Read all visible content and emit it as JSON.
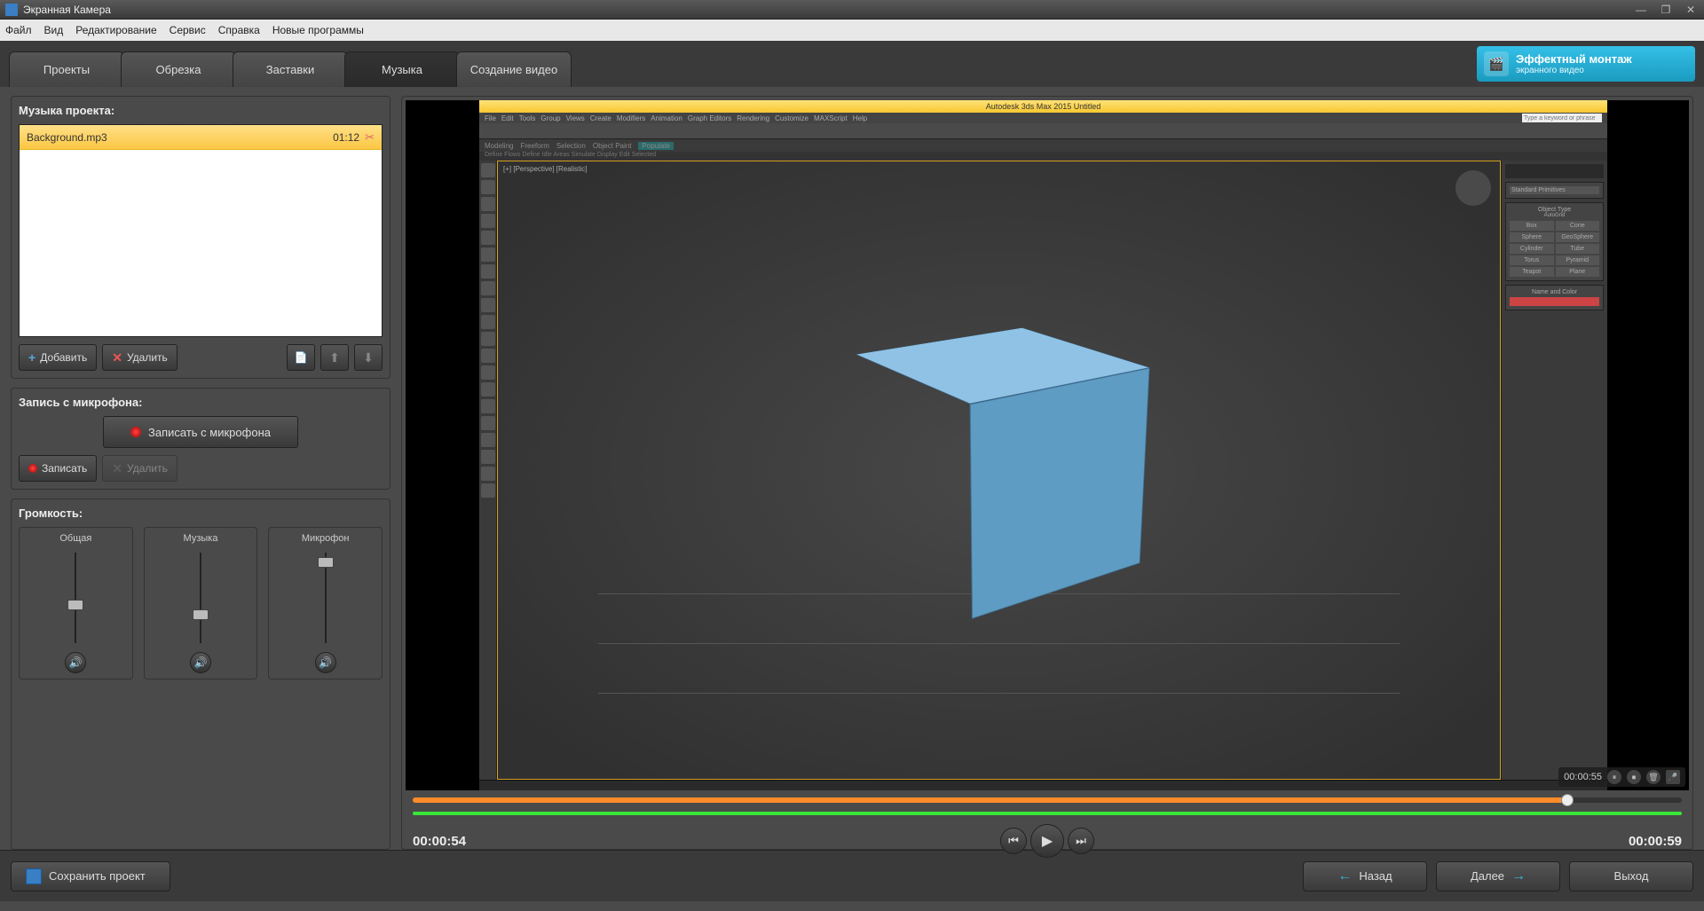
{
  "window": {
    "title": "Экранная Камера"
  },
  "menu": [
    "Файл",
    "Вид",
    "Редактирование",
    "Сервис",
    "Справка",
    "Новые программы"
  ],
  "tabs": [
    "Проекты",
    "Обрезка",
    "Заставки",
    "Музыка",
    "Создание видео"
  ],
  "active_tab_index": 3,
  "promo": {
    "title": "Эффектный монтаж",
    "subtitle": "экранного видео"
  },
  "music": {
    "section_title": "Музыка проекта:",
    "items": [
      {
        "name": "Background.mp3",
        "time": "01:12"
      }
    ],
    "add_label": "Добавить",
    "delete_label": "Удалить"
  },
  "mic": {
    "section_title": "Запись с микрофона:",
    "record_big_label": "Записать с микрофона",
    "record_label": "Записать",
    "delete_label": "Удалить"
  },
  "volume": {
    "section_title": "Громкость:",
    "general": "Общая",
    "music": "Музыка",
    "mic": "Микрофон"
  },
  "preview": {
    "embedded_title": "Autodesk 3ds Max 2015   Untitled",
    "embedded_menu": [
      "File",
      "Edit",
      "Tools",
      "Group",
      "Views",
      "Create",
      "Modifiers",
      "Animation",
      "Graph Editors",
      "Rendering",
      "Customize",
      "MAXScript",
      "Help"
    ],
    "embedded_subribbon": [
      "Modeling",
      "Freeform",
      "Selection",
      "Object Paint",
      "Populate"
    ],
    "embedded_sub2": "Define Flows   Define Idle Areas   Simulate   Display   Edit Selected",
    "viewport_label": "[+] [Perspective] [Realistic]",
    "right_dropdown": "Standard Primitives",
    "right_section_object": "Object Type",
    "right_autogrid": "AutoGrid",
    "object_buttons": [
      "Box",
      "Cone",
      "Sphere",
      "GeoSphere",
      "Cylinder",
      "Tube",
      "Torus",
      "Pyramid",
      "Teapot",
      "Plane"
    ],
    "right_section_name": "Name and Color",
    "search_placeholder": "Type a keyword or phrase",
    "badge_time": "00:00:55"
  },
  "timeline": {
    "current_time": "00:00:54",
    "total_time": "00:00:59"
  },
  "footer": {
    "save_project": "Сохранить проект",
    "back": "Назад",
    "next": "Далее",
    "exit": "Выход"
  }
}
